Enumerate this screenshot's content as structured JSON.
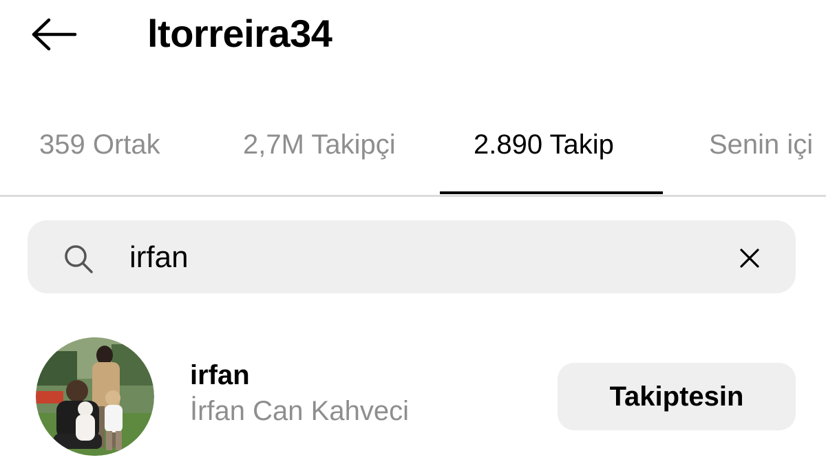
{
  "header": {
    "title": "ltorreira34"
  },
  "tabs": [
    {
      "label": "359 Ortak",
      "active": false
    },
    {
      "label": "2,7M Takipçi",
      "active": false
    },
    {
      "label": "2.890 Takip",
      "active": true
    },
    {
      "label": "Senin içi",
      "active": false
    }
  ],
  "search": {
    "value": "irfan",
    "placeholder": ""
  },
  "results": [
    {
      "username": "irfan",
      "full_name": "İrfan Can Kahveci",
      "button_label": "Takiptesin"
    }
  ],
  "icons": {
    "back": "arrow-left-icon",
    "search": "search-icon",
    "clear": "close-icon"
  },
  "colors": {
    "text_primary": "#000000",
    "text_secondary": "#8e8e8e",
    "surface": "#efefef",
    "divider": "#dbdbdb"
  }
}
